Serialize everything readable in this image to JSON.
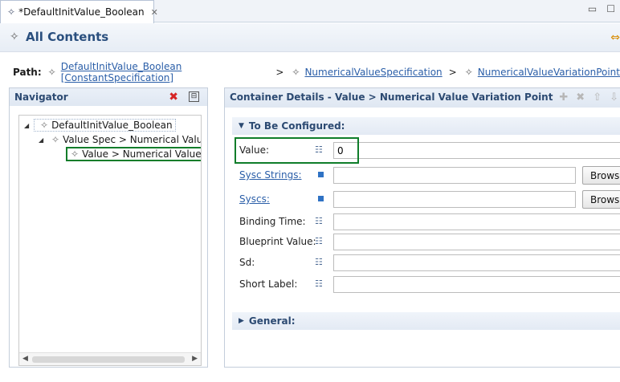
{
  "tab": {
    "title": "*DefaultInitValue_Boolean",
    "icon": "element-icon",
    "close": "✕"
  },
  "window_buttons": {
    "minimize": "▭",
    "maximize": "☐"
  },
  "header": {
    "title": "All Contents",
    "icon": "element-icon",
    "sync_icon": "link-with-editor-icon"
  },
  "path": {
    "label": "Path:",
    "separator": ">",
    "crumbs": [
      "DefaultInitValue_Boolean [ConstantSpecification]",
      "NumericalValueSpecification",
      "NumericalValueVariationPoint"
    ]
  },
  "navigator": {
    "title": "Navigator",
    "tree": {
      "root": "DefaultInitValue_Boolean",
      "child": "Value Spec > Numerical Value",
      "grandchild": "Value > Numerical Value V"
    }
  },
  "details": {
    "title": "Container Details - Value > Numerical Value Variation Point",
    "sections": {
      "configured": "To Be Configured:",
      "general": "General:"
    },
    "fields": {
      "value": {
        "label": "Value:",
        "value": "0"
      },
      "sysc_strings": {
        "label": "Sysc Strings:",
        "value": "",
        "button": "Browse"
      },
      "syscs": {
        "label": "Syscs:",
        "value": "",
        "button": "Browse"
      },
      "binding_time": {
        "label": "Binding Time:",
        "value": ""
      },
      "blueprint_value": {
        "label": "Blueprint Value:",
        "value": ""
      },
      "sd": {
        "label": "Sd:",
        "value": ""
      },
      "short_label": {
        "label": "Short Label:",
        "value": ""
      }
    }
  },
  "colors": {
    "link": "#2a5ea8",
    "panel_title": "#2c4a72",
    "highlight": "#0f7d2a",
    "delete": "#d62525",
    "sync": "#d78b00"
  }
}
